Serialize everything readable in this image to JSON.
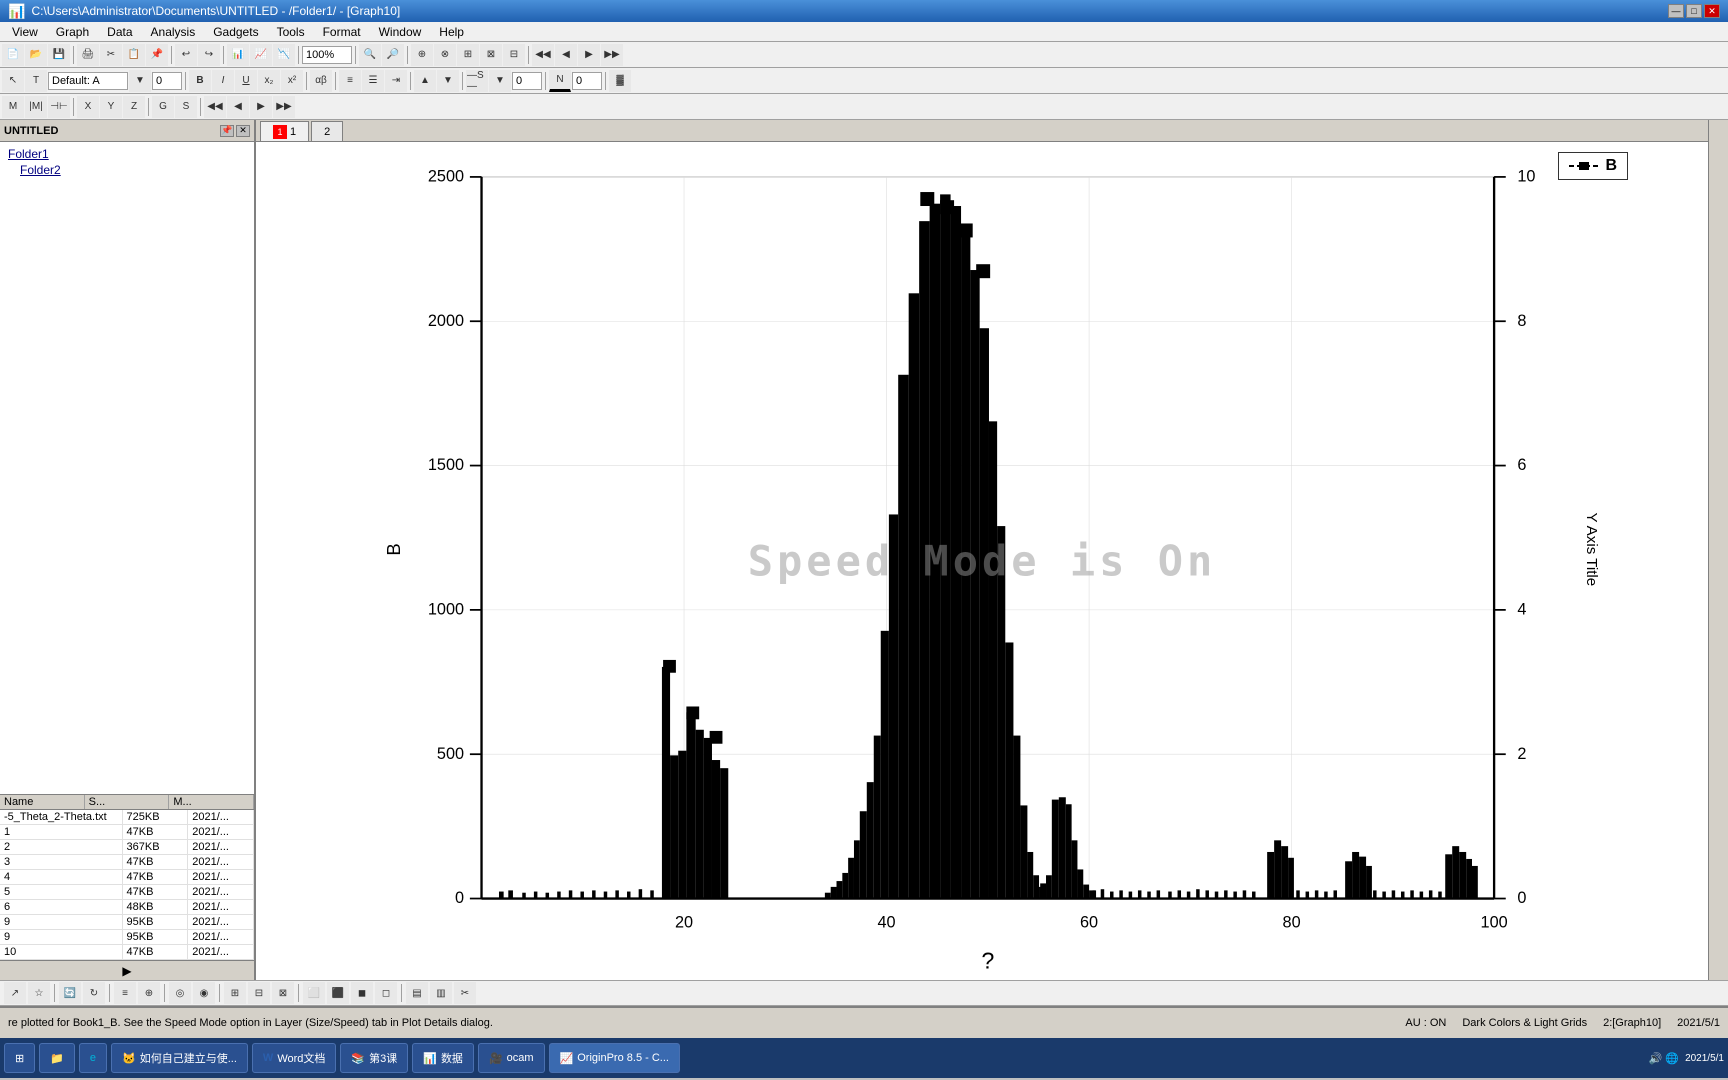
{
  "titlebar": {
    "title": "C:\\Users\\Administrator\\Documents\\UNTITLED - /Folder1/ - [Graph10]",
    "min": "—",
    "max": "□",
    "close": "✕"
  },
  "menu": {
    "items": [
      "View",
      "Graph",
      "Data",
      "Analysis",
      "Gadgets",
      "Tools",
      "Format",
      "Window",
      "Help"
    ]
  },
  "toolbar1": {
    "zoom": "100%"
  },
  "left_panel": {
    "title": "UNTITLED",
    "items": [
      "Folder1",
      "Folder2"
    ]
  },
  "file_table": {
    "headers": [
      "Name",
      "S...",
      "M..."
    ],
    "rows": [
      {
        "name": "-5_Theta_2-Theta.txt",
        "size": "725KB",
        "date": "2021/..."
      },
      {
        "name": "1",
        "size": "47KB",
        "date": "2021/..."
      },
      {
        "name": "2",
        "size": "367KB",
        "date": "2021/..."
      },
      {
        "name": "3",
        "size": "47KB",
        "date": "2021/..."
      },
      {
        "name": "4",
        "size": "47KB",
        "date": "2021/..."
      },
      {
        "name": "5",
        "size": "47KB",
        "date": "2021/..."
      },
      {
        "name": "6",
        "size": "48KB",
        "date": "2021/..."
      },
      {
        "name": "9",
        "size": "95KB",
        "date": "2021/..."
      },
      {
        "name": "9",
        "size": "95KB",
        "date": "2021/..."
      },
      {
        "name": "10",
        "size": "47KB",
        "date": "2021/..."
      }
    ]
  },
  "graph_tabs": {
    "tab1_label": "1",
    "tab2_label": "2"
  },
  "graph": {
    "title": "",
    "x_label": "?",
    "y_left_label": "B",
    "y_right_label": "Y Axis Title",
    "legend_label": "B",
    "speed_mode_text": "Speed Mode is On",
    "x_ticks": [
      "20",
      "40",
      "60",
      "80",
      "100"
    ],
    "y_left_ticks": [
      "0",
      "500",
      "1000",
      "1500",
      "2000",
      "2500"
    ],
    "y_right_ticks": [
      "0",
      "2",
      "4",
      "6",
      "8",
      "10"
    ]
  },
  "status_bar": {
    "message": "re plotted for Book1_B. See the Speed Mode option in Layer (Size/Speed) tab in Plot Details dialog.",
    "au_info": "AU : ON",
    "colors": "Dark Colors & Light Grids",
    "graph_ref": "2:[Graph10]",
    "datetime": "2021/5/1"
  },
  "taskbar": {
    "start_label": "Start",
    "items": [
      "如何自己建立与使...",
      "Word文档",
      "第3课",
      "数据",
      "ocam",
      "OriginPro 8.5 - C..."
    ]
  }
}
